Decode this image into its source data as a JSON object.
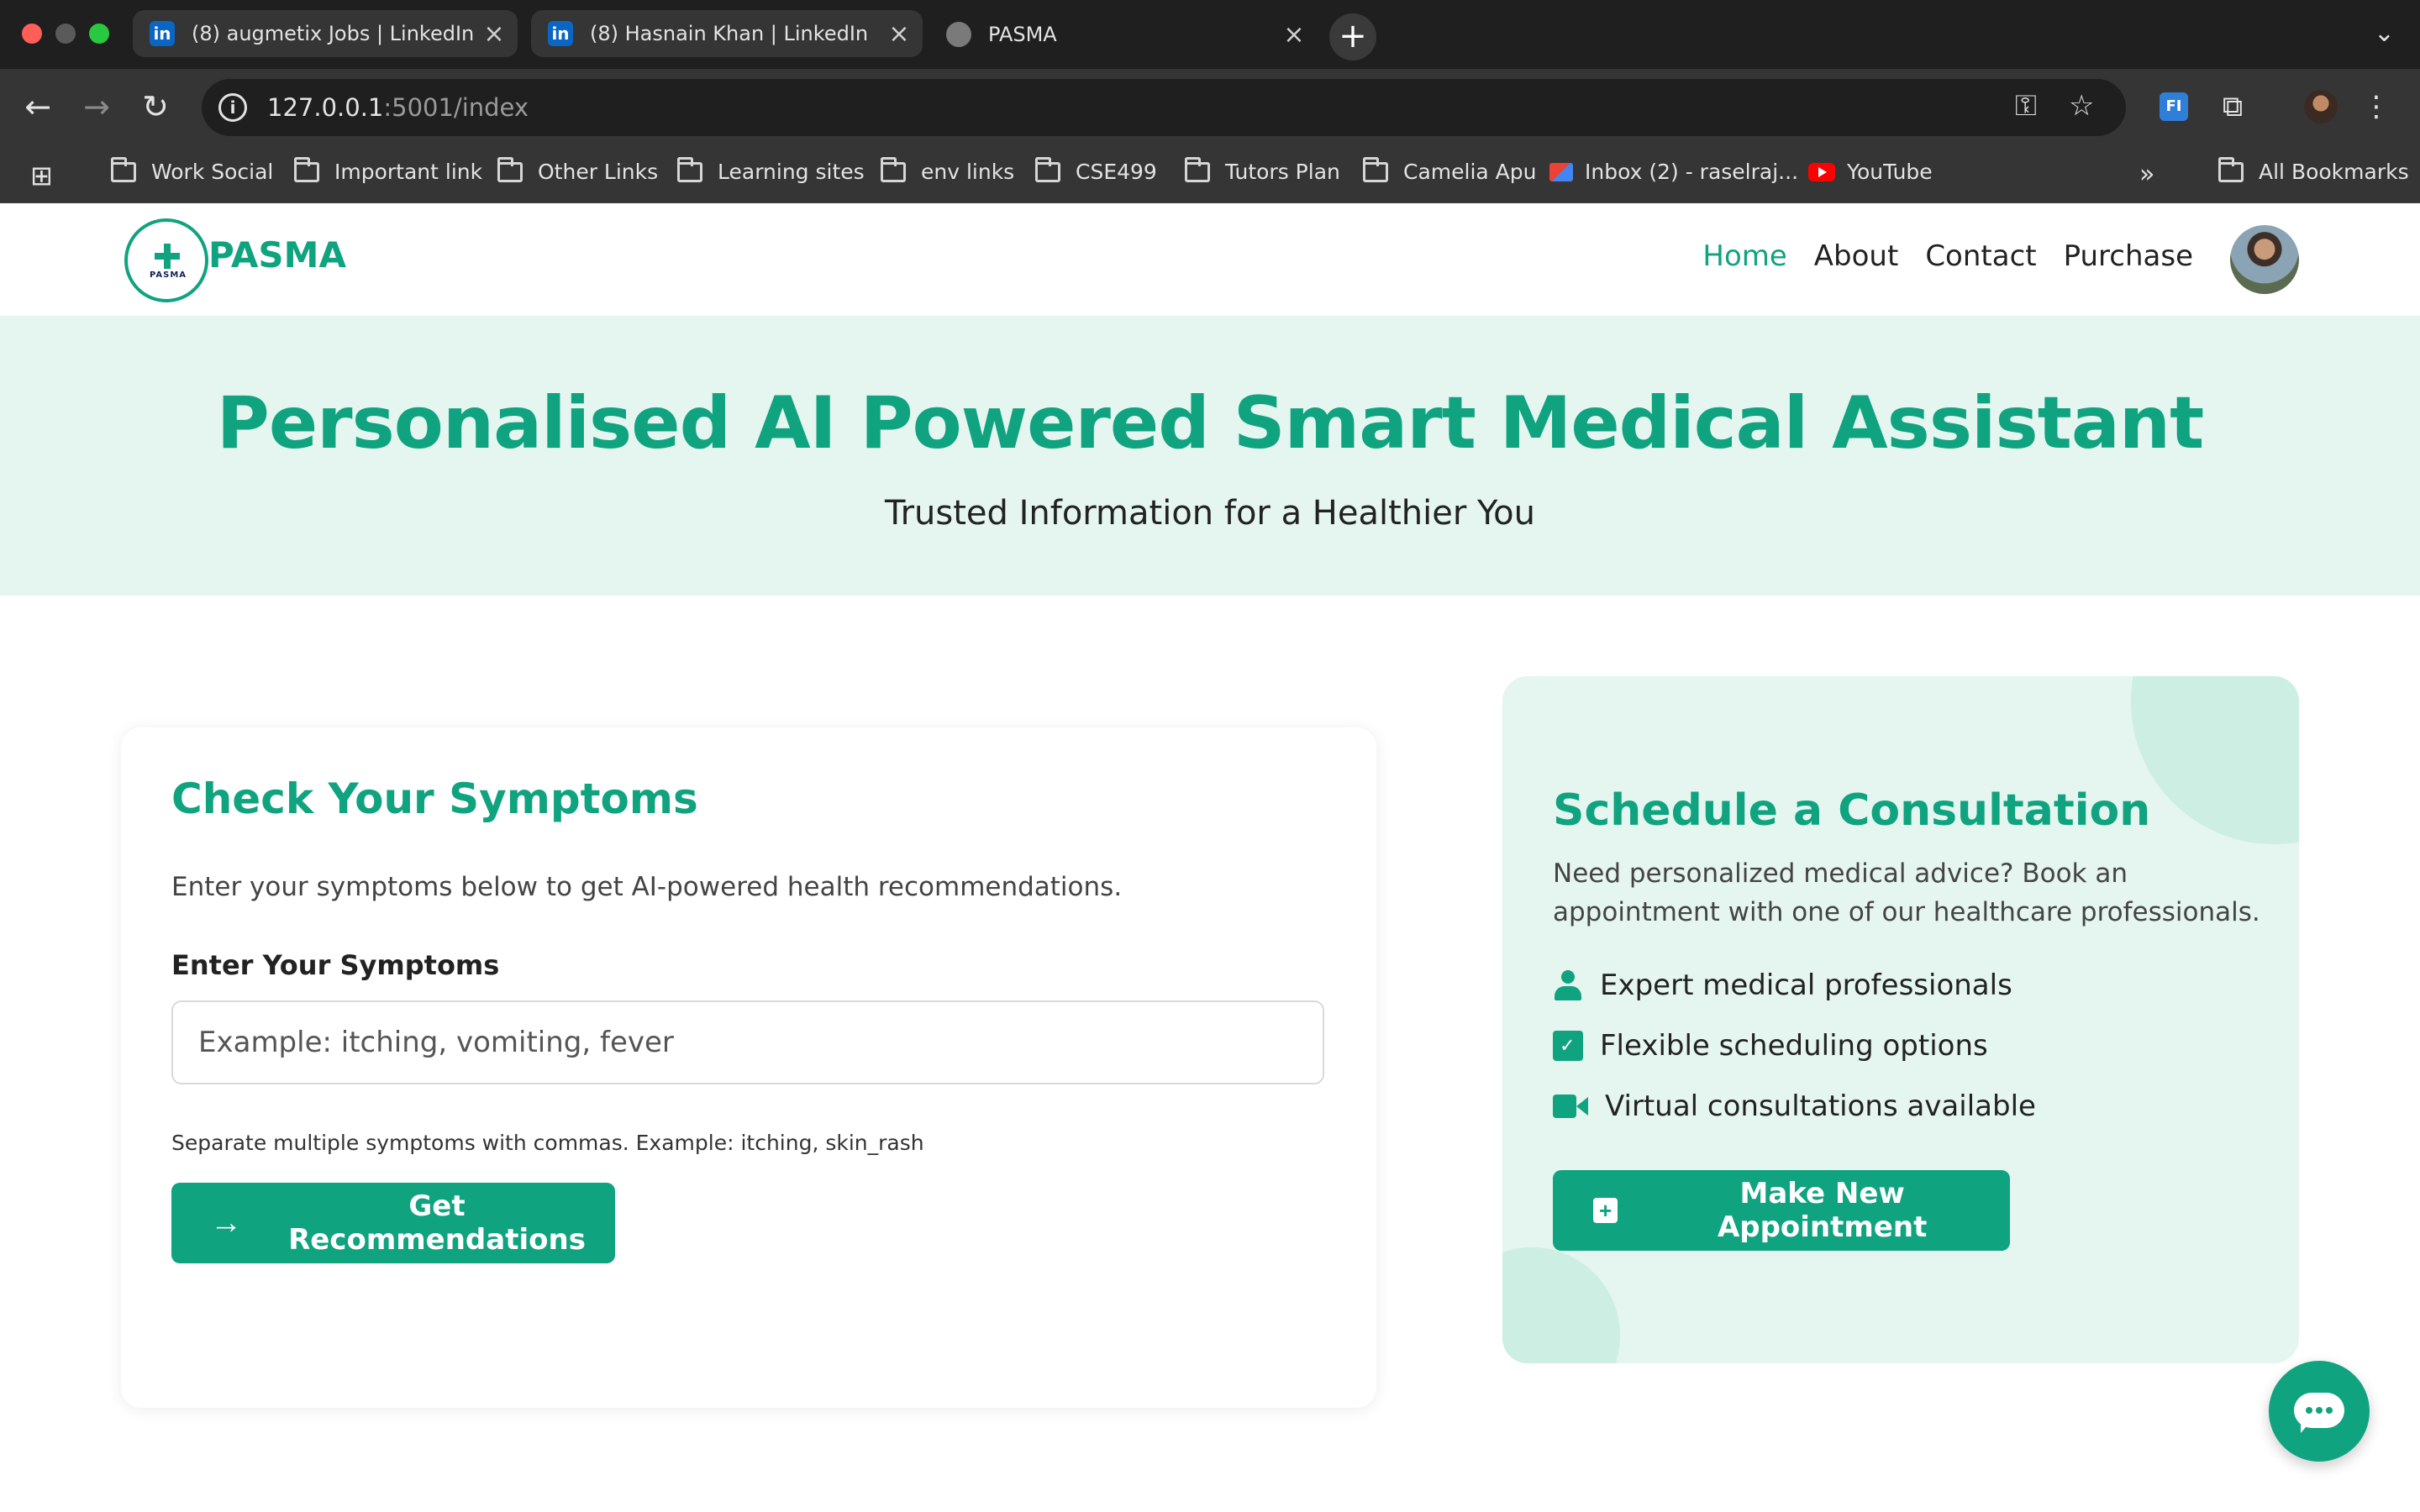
{
  "browser": {
    "tabs": [
      {
        "title": "(8) augmetix Jobs | LinkedIn",
        "favicon": "linkedin-icon"
      },
      {
        "title": "(8) Hasnain Khan | LinkedIn",
        "favicon": "linkedin-icon"
      },
      {
        "title": "PASMA",
        "favicon": "globe-icon"
      }
    ],
    "url_host": "127.0.0.1",
    "url_rest": ":5001/index",
    "bookmarks": [
      {
        "label": "Work Social",
        "icon": "folder-icon"
      },
      {
        "label": "Important link",
        "icon": "folder-icon"
      },
      {
        "label": "Other Links",
        "icon": "folder-icon"
      },
      {
        "label": "Learning sites",
        "icon": "folder-icon"
      },
      {
        "label": "env links",
        "icon": "folder-icon"
      },
      {
        "label": "CSE499",
        "icon": "folder-icon"
      },
      {
        "label": "Tutors Plan",
        "icon": "folder-icon"
      },
      {
        "label": "Camelia Apu",
        "icon": "folder-icon"
      },
      {
        "label": "Inbox (2) - raselraj...",
        "icon": "gmail-icon"
      },
      {
        "label": "YouTube",
        "icon": "youtube-icon"
      }
    ],
    "all_bookmarks": "All Bookmarks",
    "extension_label": "FI"
  },
  "site": {
    "brand": "PASMA",
    "logo_text": "PASMA",
    "nav": {
      "home": "Home",
      "about": "About",
      "contact": "Contact",
      "purchase": "Purchase"
    },
    "accent_color": "#10a37f"
  },
  "hero": {
    "title": "Personalised AI Powered Smart Medical Assistant",
    "subtitle": "Trusted Information for a Healthier You"
  },
  "symptoms": {
    "title": "Check Your Symptoms",
    "description": "Enter your symptoms below to get AI-powered health recommendations.",
    "label": "Enter Your Symptoms",
    "placeholder": "Example: itching, vomiting, fever",
    "help": "Separate multiple symptoms with commas. Example: itching, skin_rash",
    "button": "Get Recommendations"
  },
  "consultation": {
    "title": "Schedule a Consultation",
    "description": "Need personalized medical advice? Book an appointment with one of our healthcare professionals.",
    "features": [
      {
        "text": "Expert medical professionals",
        "icon": "doctor-icon"
      },
      {
        "text": "Flexible scheduling options",
        "icon": "calendar-check-icon"
      },
      {
        "text": "Virtual consultations available",
        "icon": "video-icon"
      }
    ],
    "button": "Make New Appointment"
  }
}
